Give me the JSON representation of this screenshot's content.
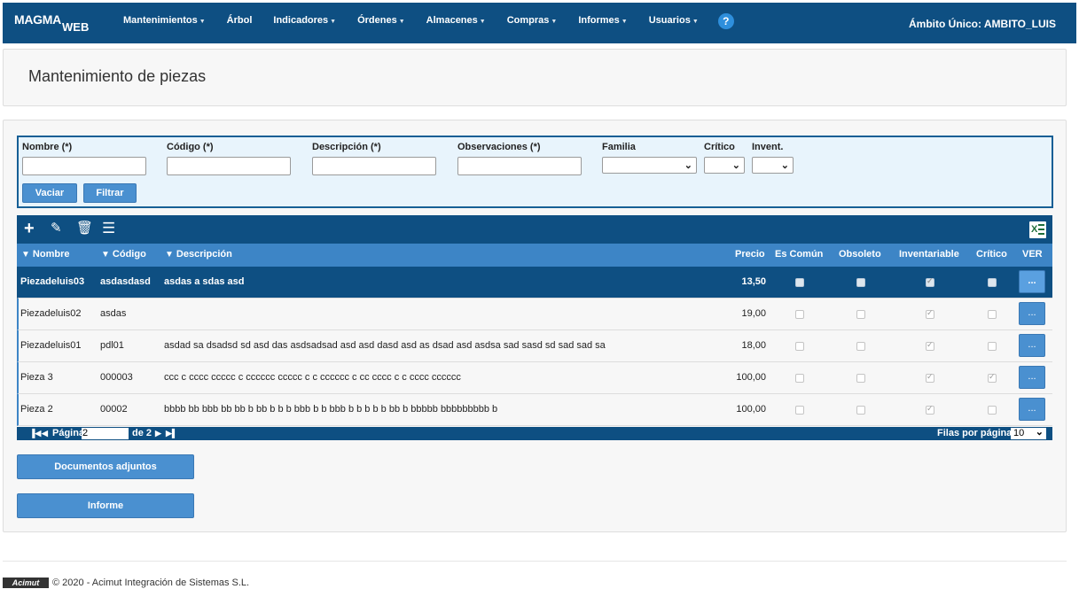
{
  "nav": {
    "brand_main": "MAGMA",
    "brand_sub": "WEB",
    "items": [
      {
        "label": "Mantenimientos",
        "dropdown": true
      },
      {
        "label": "Árbol",
        "dropdown": false
      },
      {
        "label": "Indicadores",
        "dropdown": true
      },
      {
        "label": "Órdenes",
        "dropdown": true
      },
      {
        "label": "Almacenes",
        "dropdown": true
      },
      {
        "label": "Compras",
        "dropdown": true
      },
      {
        "label": "Informes",
        "dropdown": true
      },
      {
        "label": "Usuarios",
        "dropdown": true
      }
    ],
    "help": "?",
    "scope": "Ámbito Único: AMBITO_LUIS"
  },
  "page": {
    "title": "Mantenimiento de piezas"
  },
  "filters": {
    "nombre_label": "Nombre (*)",
    "codigo_label": "Código (*)",
    "descripcion_label": "Descripción (*)",
    "observaciones_label": "Observaciones (*)",
    "familia_label": "Familia",
    "critico_label": "Crítico",
    "invent_label": "Invent.",
    "nombre_value": "",
    "codigo_value": "",
    "descripcion_value": "",
    "observaciones_value": "",
    "vaciar_label": "Vaciar",
    "filtrar_label": "Filtrar"
  },
  "grid": {
    "columns": {
      "nombre": "Nombre",
      "codigo": "Código",
      "descripcion": "Descripción",
      "precio": "Precio",
      "es_comun": "Es Común",
      "obsoleto": "Obsoleto",
      "inventariable": "Inventariable",
      "critico": "Crítico",
      "ver": "VER"
    },
    "rows": [
      {
        "nombre": "Piezadeluis03",
        "codigo": "asdasdasd",
        "descripcion": "asdas a sdas asd",
        "precio": "13,50",
        "es_comun": false,
        "obsoleto": false,
        "inventariable": true,
        "critico": false,
        "ver": "...",
        "selected": true
      },
      {
        "nombre": "Piezadeluis02",
        "codigo": "asdas",
        "descripcion": "",
        "precio": "19,00",
        "es_comun": false,
        "obsoleto": false,
        "inventariable": true,
        "critico": false,
        "ver": "...",
        "selected": false
      },
      {
        "nombre": "Piezadeluis01",
        "codigo": "pdl01",
        "descripcion": "asdad sa dsadsd sd asd das asdsadsad asd asd dasd asd as dsad asd asdsa sad sasd sd sad sad sa",
        "precio": "18,00",
        "es_comun": false,
        "obsoleto": false,
        "inventariable": true,
        "critico": false,
        "ver": "...",
        "selected": false
      },
      {
        "nombre": "Pieza 3",
        "codigo": "000003",
        "descripcion": "ccc c cccc ccccc c cccccc ccccc c c cccccc c cc cccc c c cccc cccccc",
        "precio": "100,00",
        "es_comun": false,
        "obsoleto": false,
        "inventariable": true,
        "critico": true,
        "ver": "...",
        "selected": false
      },
      {
        "nombre": "Pieza 2",
        "codigo": "00002",
        "descripcion": "bbbb bb bbb bb bb b bb b b b bbb b b bbb b b b b b bb b bbbbb bbbbbbbbb b",
        "precio": "100,00",
        "es_comun": false,
        "obsoleto": false,
        "inventariable": true,
        "critico": false,
        "ver": "...",
        "selected": false
      }
    ]
  },
  "pager": {
    "first": "⏮",
    "prev": "◀",
    "page_label": "Página",
    "page_value": "2",
    "of_label": "de 2",
    "next": "▶",
    "last": "⏭",
    "rows_label": "Filas por página:",
    "rows_value": "10"
  },
  "actions": {
    "documentos": "Documentos adjuntos",
    "informe": "Informe"
  },
  "footer": {
    "logo": "Acimut",
    "copyright": "© 2020 - Acimut Integración de Sistemas S.L."
  }
}
